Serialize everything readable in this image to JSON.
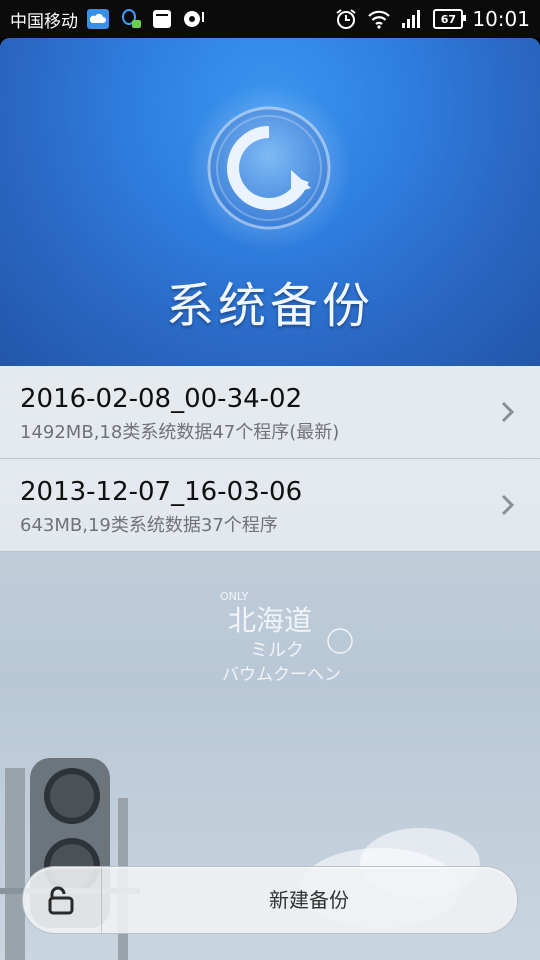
{
  "status_bar": {
    "carrier": "中国移动",
    "battery": "67",
    "time": "10:01",
    "icons": [
      "cloud-icon",
      "qq-icon",
      "message-icon",
      "chat-icon",
      "alarm-icon",
      "wifi-icon",
      "signal-icon",
      "battery-icon"
    ]
  },
  "header": {
    "title": "系统备份",
    "logo_icon": "backup-logo-icon"
  },
  "backups": [
    {
      "name": "2016-02-08_00-34-02",
      "details": "1492MB,18类系统数据47个程序(最新)"
    },
    {
      "name": "2013-12-07_16-03-06",
      "details": "643MB,19类系统数据37个程序"
    }
  ],
  "bottom_bar": {
    "lock_icon": "unlock-icon",
    "new_backup_label": "新建备份"
  },
  "watermark": {
    "line1": "ONLY",
    "line2": "北海道",
    "line3": "ミルク",
    "line4": "バウムクーヘン"
  },
  "colors": {
    "header_blue": "#2f7fe0",
    "status_bg": "#0b0b0b"
  }
}
